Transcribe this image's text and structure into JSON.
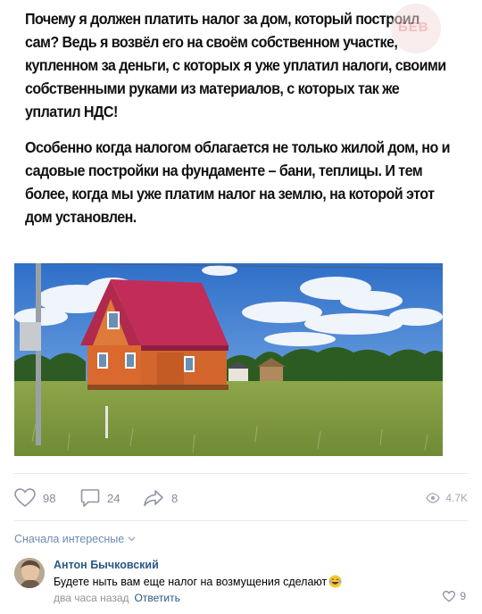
{
  "post": {
    "paragraphs": [
      "Почему я должен платить налог за дом, который построил сам? Ведь я возвёл его на своём собственном участке, купленном за деньги, с которых я уже уплатил налоги, своими собственными руками из материалов, с которых так же уплатил НДС!",
      "Особенно когда налогом облагается не только жилой дом, но и садовые постройки на фундаменте – бани, теплицы. И тем более, когда мы уже платим налог на землю, на которой этот дом установлен."
    ],
    "watermark": "БЕВ",
    "image_icon": "house-photo"
  },
  "actions": {
    "likes": "98",
    "comments": "24",
    "shares": "8",
    "views": "4.7K",
    "icons": [
      "heart-icon",
      "comment-icon",
      "share-icon",
      "eye-icon"
    ]
  },
  "comments": {
    "sort_label": "Сначала интересные",
    "items": [
      {
        "author": "Антон Бычковский",
        "text": "Будете ныть вам еще налог на возмущения сделают",
        "time": "два часа назад",
        "reply_label": "Ответить",
        "likes": "9"
      }
    ]
  },
  "colors": {
    "link": "#2a5885",
    "muted": "#828a99",
    "sort": "#6e8bb0"
  }
}
